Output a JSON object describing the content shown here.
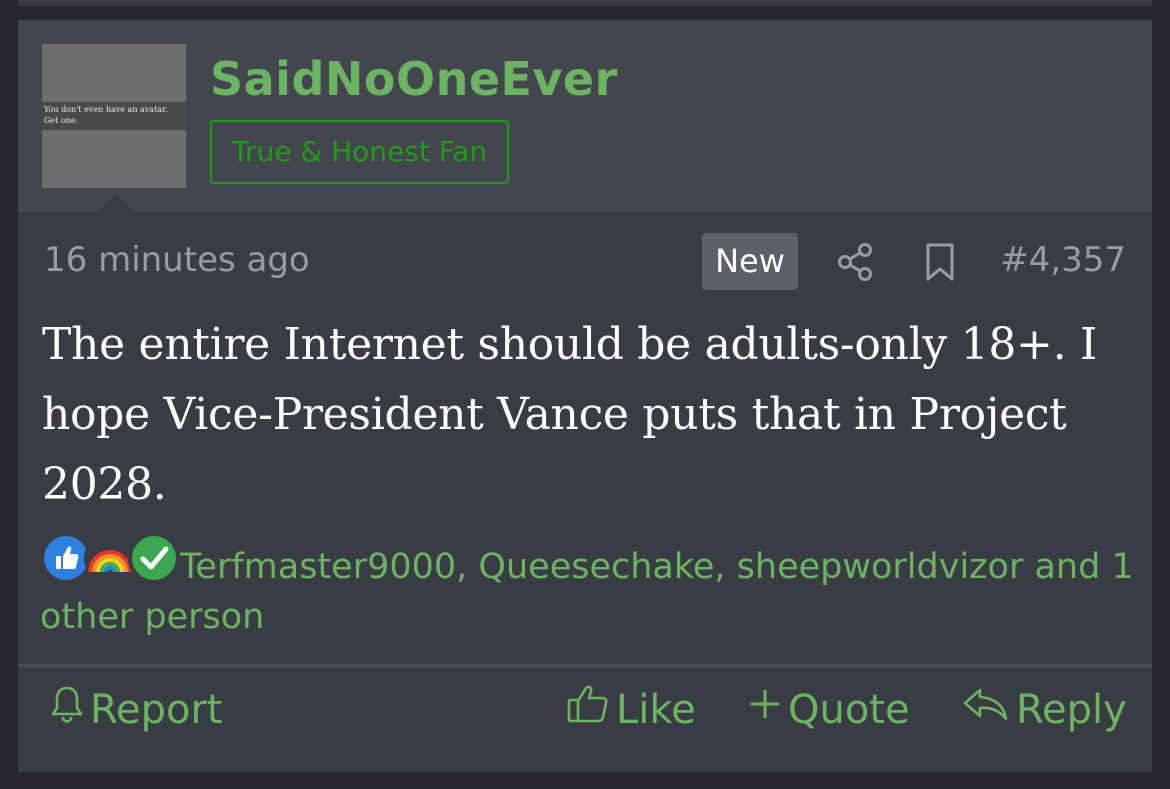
{
  "post": {
    "username": "SaidNoOneEver",
    "user_title": "True & Honest Fan",
    "avatar_text": "You don't even have an avatar.\nGet one.",
    "time": "16 minutes ago",
    "badge": "New",
    "post_number": "#4,357",
    "message": "The entire Internet should be adults-only 18+. I hope Vice-President Vance puts that in Project 2028.",
    "reactions": {
      "icons": [
        "thumbs-up-icon",
        "rainbow-icon",
        "checkmark-icon"
      ],
      "text": "Terfmaster9000, Queesechake, sheepworldvizor and 1 other person"
    }
  },
  "actions": {
    "report": "Report",
    "like": "Like",
    "quote": "Quote",
    "reply": "Reply"
  },
  "colors": {
    "background": "#26282c",
    "post_body": "#393c42",
    "user_header": "#43464c",
    "accent_green": "#6cb463",
    "title_green": "#1f9b16",
    "muted_text": "#9a9ca0"
  }
}
